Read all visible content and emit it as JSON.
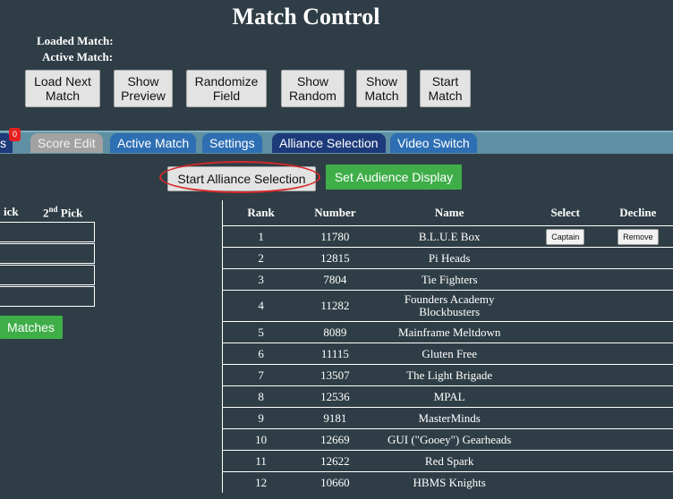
{
  "header": {
    "title": "Match Control",
    "loaded_match_label": "Loaded Match:",
    "active_match_label": "Active Match:"
  },
  "controls": [
    {
      "line1": "Load Next",
      "line2": "Match"
    },
    {
      "line1": "Show",
      "line2": "Preview"
    },
    {
      "line1": "Randomize",
      "line2": "Field"
    },
    {
      "line1": "Show",
      "line2": "Random"
    },
    {
      "line1": "Show",
      "line2": "Match"
    },
    {
      "line1": "Start",
      "line2": "Match"
    }
  ],
  "tabs": {
    "badge_count": "0",
    "partial_label": "s",
    "items": [
      "Score Edit",
      "Active Match",
      "Settings",
      "Alliance Selection",
      "Video Switch"
    ]
  },
  "actions": {
    "start_alliance_selection": "Start Alliance Selection",
    "set_audience_display": "Set Audience Display",
    "matches": "Matches"
  },
  "alliance_grid": {
    "col1": "ick",
    "col2_prefix": "2",
    "col2_sup": "nd",
    "col2_suffix": " Pick"
  },
  "rankings": {
    "headers": [
      "Rank",
      "Number",
      "Name",
      "Select",
      "Decline"
    ],
    "captain_label": "Captain",
    "remove_label": "Remove",
    "rows": [
      {
        "rank": "1",
        "number": "11780",
        "name": "B.L.U.E Box"
      },
      {
        "rank": "2",
        "number": "12815",
        "name": "Pi Heads"
      },
      {
        "rank": "3",
        "number": "7804",
        "name": "Tie Fighters"
      },
      {
        "rank": "4",
        "number": "11282",
        "name": "Founders Academy Blockbusters"
      },
      {
        "rank": "5",
        "number": "8089",
        "name": "Mainframe Meltdown"
      },
      {
        "rank": "6",
        "number": "11115",
        "name": "Gluten Free"
      },
      {
        "rank": "7",
        "number": "13507",
        "name": "The Light Brigade"
      },
      {
        "rank": "8",
        "number": "12536",
        "name": "MPAL"
      },
      {
        "rank": "9",
        "number": "9181",
        "name": "MasterMinds"
      },
      {
        "rank": "10",
        "number": "12669",
        "name": "GUI (\"Gooey\") Gearheads"
      },
      {
        "rank": "11",
        "number": "12622",
        "name": "Red Spark"
      },
      {
        "rank": "12",
        "number": "10660",
        "name": "HBMS Knights"
      }
    ]
  }
}
